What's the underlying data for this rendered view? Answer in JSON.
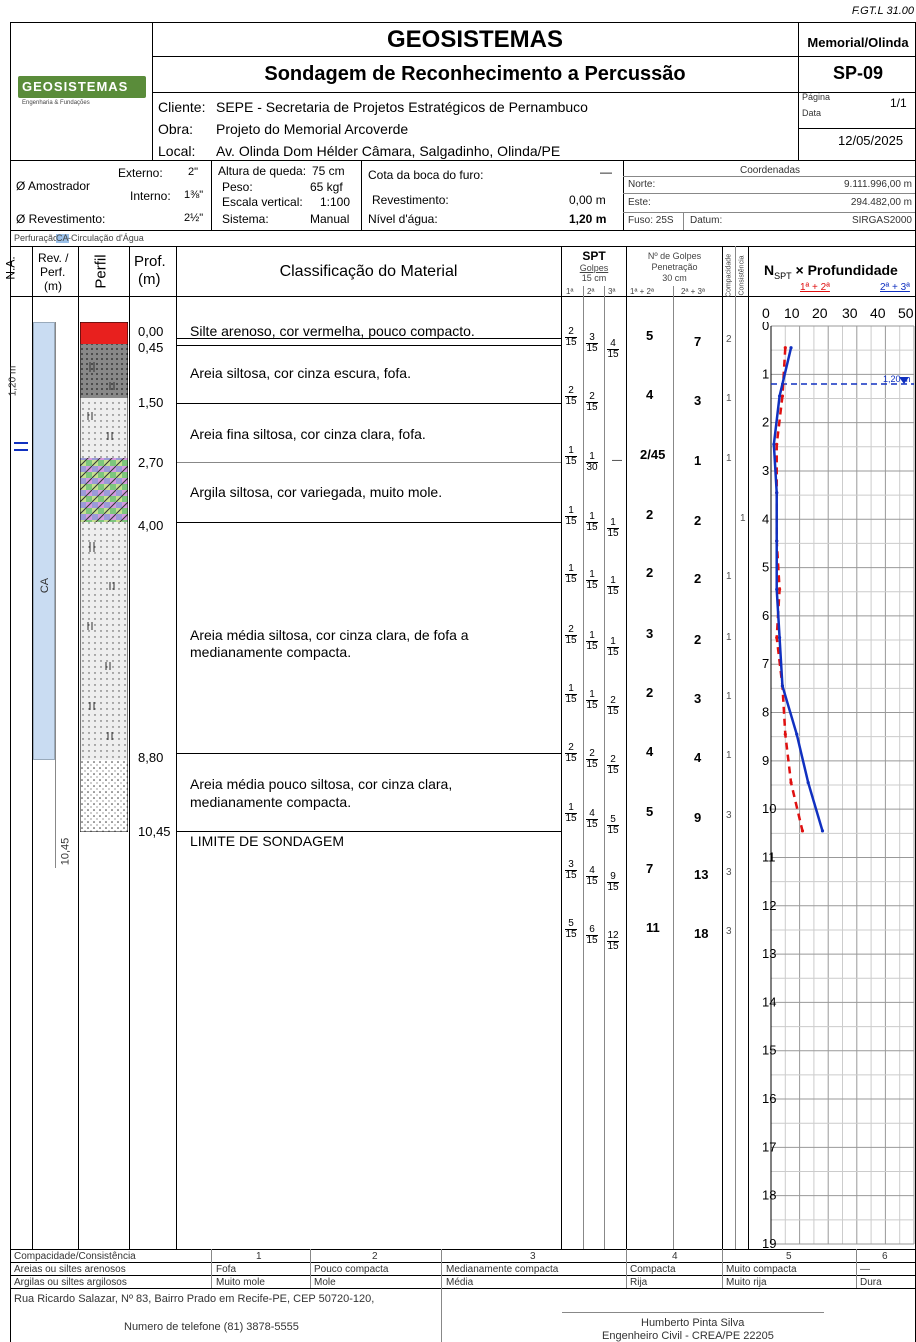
{
  "form_code": "F.GT.L 31.00",
  "company": "GEOSISTEMAS",
  "logo_text": "GEOSISTEMAS",
  "logo_sub": "Engenharia & Fundações",
  "report_title": "Sondagem de Reconhecimento a Percussão",
  "project_short": "Memorial/Olinda",
  "boring_id": "SP-09",
  "page_label": "Página",
  "page_value": "1/1",
  "date_label": "Data",
  "date_value": "12/05/2025",
  "client_label": "Cliente:",
  "client_value": "SEPE - Secretaria de Projetos Estratégicos de Pernambuco",
  "work_label": "Obra:",
  "work_value": "Projeto do Memorial Arcoverde",
  "location_label": "Local:",
  "location_value": "Av. Olinda Dom Hélder Câmara, Salgadinho, Olinda/PE",
  "params": {
    "sampler_label": "Ø Amostrador",
    "ext_label": "Externo:",
    "ext_value": "2\"",
    "int_label": "Interno:",
    "int_value": "1⅜\"",
    "casing_label": "Ø Revestimento:",
    "casing_value": "2½\"",
    "fall_label": "Altura de queda:",
    "fall_value": "75 cm",
    "weight_label": "Peso:",
    "weight_value": "65 kgf",
    "scale_label": "Escala vertical:",
    "scale_value": "1:100",
    "system_label": "Sistema:",
    "system_value": "Manual",
    "mouth_label": "Cota da boca do furo:",
    "mouth_value": "—",
    "rev_label": "Revestimento:",
    "rev_value": "0,00 m",
    "water_label": "Nível d'água:",
    "water_value": "1,20 m"
  },
  "coords": {
    "title": "Coordenadas",
    "north_label": "Norte:",
    "north_value": "9.111.996,00 m",
    "east_label": "Este:",
    "east_value": "294.482,00 m",
    "zone_label": "Fuso: 25S",
    "datum_label": "Datum:",
    "datum_value": "SIRGAS2000"
  },
  "perforation_note_prefix": "Perfuração:",
  "perforation_code": "CA",
  "perforation_note_suffix": "-Circulação d'Água",
  "headers": {
    "na": "N.A.",
    "rev1": "Rev. /",
    "rev2": "Perf.",
    "rev3": "(m)",
    "perfil": "Perfil",
    "prof1": "Prof.",
    "prof2": "(m)",
    "classif": "Classificação do Material",
    "spt": "SPT",
    "golpes": "Golpes",
    "cm15": "15 cm",
    "n1": "1ª",
    "n2": "2ª",
    "n3": "3ª",
    "ngolpes1": "Nº de Golpes",
    "ngolpes2": "Penetração",
    "ngolpes3": "30 cm",
    "s12": "1ª + 2ª",
    "s23": "2ª + 3ª",
    "compac": "Compacidade",
    "consist": "Consistência",
    "nspt_a": "N",
    "nspt_sub": "SPT",
    "nspt_b": " × Profundidade",
    "leg1": "1ª + 2ª",
    "leg2": "2ª + 3ª",
    "axis": [
      "0",
      "10",
      "20",
      "30",
      "40",
      "50"
    ]
  },
  "na_value": "1,20 m",
  "na_chart_label": "1,20 m",
  "rev_code": "CA",
  "end_depth_label": "10,45",
  "depths": [
    "0,00",
    "0,45",
    "1,50",
    "2,70",
    "4,00",
    "8,80",
    "10,45"
  ],
  "layers": [
    "Silte arenoso, cor vermelha, pouco compacto.",
    "Areia siltosa, cor cinza escura, fofa.",
    "Areia fina siltosa, cor cinza clara, fofa.",
    "Argila siltosa, cor variegada, muito mole.",
    "Areia média siltosa, cor cinza clara, de fofa a",
    "medianamente compacta.",
    "Areia média pouco siltosa, cor cinza clara,",
    "medianamente compacta.",
    "LIMITE DE SONDAGEM"
  ],
  "spt_rows": [
    {
      "g1": "2",
      "g2": "3",
      "g3": "4",
      "p1": "15",
      "p2": "15",
      "p3": "15",
      "s12": "5",
      "s23": "7",
      "c": "2"
    },
    {
      "g1": "2",
      "g2": "2",
      "g3": "",
      "p1": "15",
      "p2": "15",
      "p3": "",
      "s12": "4",
      "s23": "3",
      "c": "1"
    },
    {
      "g1": "1",
      "g2": "1",
      "g3": "—",
      "p1": "15",
      "p2": "30",
      "p3": "",
      "s12": "2/45",
      "s23": "1",
      "c": "1"
    },
    {
      "g1": "1",
      "g2": "1",
      "g3": "1",
      "p1": "15",
      "p2": "15",
      "p3": "15",
      "s12": "2",
      "s23": "2",
      "c": "1"
    },
    {
      "g1": "1",
      "g2": "1",
      "g3": "1",
      "p1": "15",
      "p2": "15",
      "p3": "15",
      "s12": "2",
      "s23": "2",
      "c": "1"
    },
    {
      "g1": "2",
      "g2": "1",
      "g3": "1",
      "p1": "15",
      "p2": "15",
      "p3": "15",
      "s12": "3",
      "s23": "2",
      "c": "1"
    },
    {
      "g1": "1",
      "g2": "1",
      "g3": "2",
      "p1": "15",
      "p2": "15",
      "p3": "15",
      "s12": "2",
      "s23": "3",
      "c": "1"
    },
    {
      "g1": "2",
      "g2": "2",
      "g3": "2",
      "p1": "15",
      "p2": "15",
      "p3": "15",
      "s12": "4",
      "s23": "4",
      "c": "1"
    },
    {
      "g1": "1",
      "g2": "4",
      "g3": "5",
      "p1": "15",
      "p2": "15",
      "p3": "15",
      "s12": "5",
      "s23": "9",
      "c": "3"
    },
    {
      "g1": "3",
      "g2": "4",
      "g3": "9",
      "p1": "15",
      "p2": "15",
      "p3": "15",
      "s12": "7",
      "s23": "13",
      "c": "3"
    },
    {
      "g1": "5",
      "g2": "6",
      "g3": "12",
      "p1": "15",
      "p2": "15",
      "p3": "15",
      "s12": "11",
      "s23": "18",
      "c": "3"
    }
  ],
  "chart_data": {
    "type": "line",
    "title": "NSPT × Profundidade",
    "xlim": [
      0,
      50
    ],
    "ylim": [
      0,
      19
    ],
    "y_ticks": [
      "0",
      "1",
      "2",
      "3",
      "4",
      "5",
      "6",
      "7",
      "8",
      "9",
      "10",
      "11",
      "12",
      "13",
      "14",
      "15",
      "16",
      "17",
      "18",
      "19"
    ],
    "series": [
      {
        "name": "1ª + 2ª",
        "color": "#e01010",
        "dashed": true,
        "x": [
          5,
          4,
          2,
          2,
          2,
          3,
          2,
          4,
          5,
          7,
          11
        ],
        "y": [
          0.45,
          1.45,
          2.45,
          3.45,
          4.45,
          5.45,
          6.45,
          7.45,
          8.45,
          9.45,
          10.45
        ]
      },
      {
        "name": "2ª + 3ª",
        "color": "#1030c0",
        "dashed": false,
        "x": [
          7,
          3,
          1,
          2,
          2,
          2,
          3,
          4,
          9,
          13,
          18
        ],
        "y": [
          0.45,
          1.45,
          2.45,
          3.45,
          4.45,
          5.45,
          6.45,
          7.45,
          8.45,
          9.45,
          10.45
        ]
      }
    ]
  },
  "legend_table": {
    "h0": "Compacidade/Consistência",
    "nums": [
      "1",
      "2",
      "3",
      "4",
      "5",
      "6"
    ],
    "r1": [
      "Areias ou siltes arenosos",
      "Fofa",
      "Pouco compacta",
      "Medianamente compacta",
      "Compacta",
      "Muito compacta",
      "—"
    ],
    "r2": [
      "Argilas ou siltes argilosos",
      "Muito mole",
      "Mole",
      "Média",
      "Rija",
      "Muito rija",
      "Dura"
    ]
  },
  "footer": {
    "addr1": "Rua Ricardo Salazar, Nº 83, Bairro Prado em Recife-PE, CEP 50720-120,",
    "addr2": "Numero de telefone (81) 3878-5555",
    "eng": "Humberto Pinta Silva",
    "crea": "Engenheiro Civil - CREA/PE 22205"
  },
  "colors": {
    "red": "#e01010",
    "blue": "#1030c0",
    "na_bar": "#c9dcf2",
    "layer_red": "#e8201e"
  }
}
